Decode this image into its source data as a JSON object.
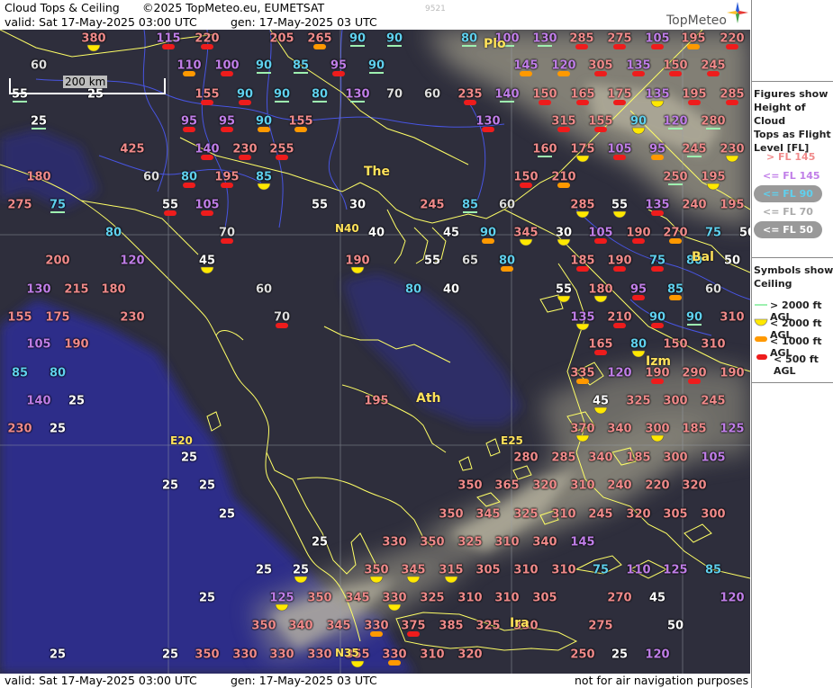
{
  "header": {
    "title": "Cloud Tops & Ceiling",
    "copyright": "©2025 TopMeteo.eu, EUMETSAT",
    "valid": "valid:  Sat  17-May-2025  03:00 UTC",
    "generated": "gen: 17-May-2025 03 UTC",
    "code": "9521",
    "brand": "TopMeteo"
  },
  "footer": {
    "valid": "valid:  Sat  17-May-2025  03:00 UTC",
    "generated": "gen: 17-May-2025 03 UTC",
    "disclaimer": "not for air navigation purposes"
  },
  "scale_label": "200 km",
  "colors": {
    "gt145": "#f08a8a",
    "le145": "#c07ee8",
    "le90": "#5fd0ee",
    "le70": "#dddddd",
    "le50": "#ffffff",
    "ceil_gt2000": "#9ef0b0",
    "ceil_lt2000": "#ffe800",
    "ceil_lt1000": "#ff9900",
    "ceil_lt500": "#ee1c1c",
    "coast": "#ffff66",
    "rivers": "#4d5cff"
  },
  "legend": {
    "figures_title": [
      "Figures show",
      "Height of Cloud",
      "Tops as Flight",
      "Level  [FL]"
    ],
    "fl_items": [
      "> FL 145",
      "<= FL 145",
      "<= FL 90",
      "<= FL 70",
      "<= FL 50"
    ],
    "symbols_title": [
      "Symbols show",
      "Ceiling"
    ],
    "ceil_items": [
      "> 2000 ft AGL",
      "< 2000 ft AGL",
      "< 1000 ft AGL",
      "< 500 ft AGL"
    ]
  },
  "places": [
    {
      "name": "Plo",
      "icon": "city-dot-icon"
    },
    {
      "name": "The",
      "icon": "city-dot-icon"
    },
    {
      "name": "Ath",
      "icon": "city-dot-icon"
    },
    {
      "name": "Izm",
      "icon": "city-dot-icon"
    },
    {
      "name": "Bal",
      "icon": "city-dot-icon"
    },
    {
      "name": "Ira",
      "icon": "city-dot-icon"
    }
  ],
  "grid_labels": [
    "N40",
    "E20",
    "E25",
    "N35"
  ],
  "points": [
    {
      "v": "380",
      "c": "gt145",
      "s": "lt2000"
    },
    {
      "v": "115",
      "c": "le145",
      "s": "lt500"
    },
    {
      "v": "220",
      "c": "gt145",
      "s": "lt500"
    },
    {
      "v": "205",
      "c": "gt145",
      "s": ""
    },
    {
      "v": "265",
      "c": "gt145",
      "s": "lt1000"
    },
    {
      "v": "90",
      "c": "le90",
      "s": "gt2000"
    },
    {
      "v": "90",
      "c": "le90",
      "s": "gt2000"
    },
    {
      "v": "80",
      "c": "le90",
      "s": "gt2000"
    },
    {
      "v": "100",
      "c": "le145",
      "s": "gt2000"
    },
    {
      "v": "130",
      "c": "le145",
      "s": "gt2000"
    },
    {
      "v": "285",
      "c": "gt145",
      "s": "lt500"
    },
    {
      "v": "275",
      "c": "gt145",
      "s": "lt500"
    },
    {
      "v": "105",
      "c": "le145",
      "s": "lt500"
    },
    {
      "v": "195",
      "c": "gt145",
      "s": "lt1000"
    },
    {
      "v": "220",
      "c": "gt145",
      "s": "lt500"
    },
    {
      "v": "60",
      "c": "le70",
      "s": ""
    },
    {
      "v": "110",
      "c": "le145",
      "s": "lt1000"
    },
    {
      "v": "100",
      "c": "le145",
      "s": "lt500"
    },
    {
      "v": "90",
      "c": "le90",
      "s": "gt2000"
    },
    {
      "v": "85",
      "c": "le90",
      "s": "gt2000"
    },
    {
      "v": "95",
      "c": "le145",
      "s": "lt500"
    },
    {
      "v": "90",
      "c": "le90",
      "s": "gt2000"
    },
    {
      "v": "145",
      "c": "le145",
      "s": "lt1000"
    },
    {
      "v": "120",
      "c": "le145",
      "s": "lt1000"
    },
    {
      "v": "305",
      "c": "gt145",
      "s": "lt500"
    },
    {
      "v": "135",
      "c": "le145",
      "s": "lt500"
    },
    {
      "v": "150",
      "c": "gt145",
      "s": "lt500"
    },
    {
      "v": "245",
      "c": "gt145",
      "s": "lt500"
    },
    {
      "v": "55",
      "c": "le50",
      "s": "gt2000"
    },
    {
      "v": "25",
      "c": "le50",
      "s": ""
    },
    {
      "v": "155",
      "c": "gt145",
      "s": "lt500"
    },
    {
      "v": "90",
      "c": "le90",
      "s": "lt500"
    },
    {
      "v": "90",
      "c": "le90",
      "s": "gt2000"
    },
    {
      "v": "80",
      "c": "le90",
      "s": "gt2000"
    },
    {
      "v": "130",
      "c": "le145",
      "s": "gt2000"
    },
    {
      "v": "70",
      "c": "le70",
      "s": ""
    },
    {
      "v": "60",
      "c": "le70",
      "s": ""
    },
    {
      "v": "235",
      "c": "gt145",
      "s": "lt500"
    },
    {
      "v": "140",
      "c": "le145",
      "s": "gt2000"
    },
    {
      "v": "150",
      "c": "gt145",
      "s": "lt500"
    },
    {
      "v": "165",
      "c": "gt145",
      "s": "lt500"
    },
    {
      "v": "175",
      "c": "gt145",
      "s": "lt500"
    },
    {
      "v": "135",
      "c": "le145",
      "s": "lt2000"
    },
    {
      "v": "195",
      "c": "gt145",
      "s": "lt500"
    },
    {
      "v": "285",
      "c": "gt145",
      "s": "lt500"
    },
    {
      "v": "25",
      "c": "le50",
      "s": "gt2000"
    },
    {
      "v": "95",
      "c": "le145",
      "s": "lt500"
    },
    {
      "v": "95",
      "c": "le145",
      "s": "lt500"
    },
    {
      "v": "90",
      "c": "le90",
      "s": "lt1000"
    },
    {
      "v": "155",
      "c": "gt145",
      "s": "lt1000"
    },
    {
      "v": "130",
      "c": "le145",
      "s": "lt500"
    },
    {
      "v": "315",
      "c": "gt145",
      "s": "lt500"
    },
    {
      "v": "155",
      "c": "gt145",
      "s": "lt500"
    },
    {
      "v": "90",
      "c": "le90",
      "s": "lt2000"
    },
    {
      "v": "120",
      "c": "le145",
      "s": "gt2000"
    },
    {
      "v": "280",
      "c": "gt145",
      "s": "gt2000"
    },
    {
      "v": "425",
      "c": "gt145",
      "s": ""
    },
    {
      "v": "140",
      "c": "le145",
      "s": "lt500"
    },
    {
      "v": "230",
      "c": "gt145",
      "s": "lt500"
    },
    {
      "v": "255",
      "c": "gt145",
      "s": "lt500"
    },
    {
      "v": "160",
      "c": "gt145",
      "s": "gt2000"
    },
    {
      "v": "175",
      "c": "gt145",
      "s": "lt2000"
    },
    {
      "v": "105",
      "c": "le145",
      "s": "lt500"
    },
    {
      "v": "95",
      "c": "le145",
      "s": "lt1000"
    },
    {
      "v": "245",
      "c": "gt145",
      "s": "gt2000"
    },
    {
      "v": "230",
      "c": "gt145",
      "s": "lt2000"
    },
    {
      "v": "180",
      "c": "gt145",
      "s": ""
    },
    {
      "v": "60",
      "c": "le70",
      "s": ""
    },
    {
      "v": "80",
      "c": "le90",
      "s": "lt500"
    },
    {
      "v": "195",
      "c": "gt145",
      "s": "lt500"
    },
    {
      "v": "85",
      "c": "le90",
      "s": "lt2000"
    },
    {
      "v": "150",
      "c": "gt145",
      "s": "lt500"
    },
    {
      "v": "210",
      "c": "gt145",
      "s": "lt1000"
    },
    {
      "v": "250",
      "c": "gt145",
      "s": "gt2000"
    },
    {
      "v": "195",
      "c": "gt145",
      "s": "lt2000"
    },
    {
      "v": "275",
      "c": "gt145",
      "s": ""
    },
    {
      "v": "75",
      "c": "le90",
      "s": "gt2000"
    },
    {
      "v": "55",
      "c": "le50",
      "s": "lt500"
    },
    {
      "v": "105",
      "c": "le145",
      "s": "lt500"
    },
    {
      "v": "55",
      "c": "le50",
      "s": ""
    },
    {
      "v": "30",
      "c": "le50",
      "s": ""
    },
    {
      "v": "245",
      "c": "gt145",
      "s": ""
    },
    {
      "v": "85",
      "c": "le90",
      "s": "gt2000"
    },
    {
      "v": "60",
      "c": "le70",
      "s": ""
    },
    {
      "v": "285",
      "c": "gt145",
      "s": "lt2000"
    },
    {
      "v": "55",
      "c": "le50",
      "s": "lt2000"
    },
    {
      "v": "135",
      "c": "le145",
      "s": "lt500"
    },
    {
      "v": "240",
      "c": "gt145",
      "s": ""
    },
    {
      "v": "195",
      "c": "gt145",
      "s": ""
    },
    {
      "v": "80",
      "c": "le90",
      "s": ""
    },
    {
      "v": "70",
      "c": "le70",
      "s": "lt500"
    },
    {
      "v": "40",
      "c": "le50",
      "s": ""
    },
    {
      "v": "45",
      "c": "le50",
      "s": ""
    },
    {
      "v": "90",
      "c": "le90",
      "s": "lt1000"
    },
    {
      "v": "345",
      "c": "gt145",
      "s": "lt2000"
    },
    {
      "v": "30",
      "c": "le50",
      "s": "lt2000"
    },
    {
      "v": "105",
      "c": "le145",
      "s": "lt500"
    },
    {
      "v": "190",
      "c": "gt145",
      "s": "lt500"
    },
    {
      "v": "270",
      "c": "gt145",
      "s": "lt1000"
    },
    {
      "v": "75",
      "c": "le90",
      "s": ""
    },
    {
      "v": "50",
      "c": "le50",
      "s": ""
    },
    {
      "v": "200",
      "c": "gt145",
      "s": ""
    },
    {
      "v": "120",
      "c": "le145",
      "s": ""
    },
    {
      "v": "45",
      "c": "le50",
      "s": "lt2000"
    },
    {
      "v": "190",
      "c": "gt145",
      "s": "lt2000"
    },
    {
      "v": "55",
      "c": "le50",
      "s": ""
    },
    {
      "v": "65",
      "c": "le70",
      "s": ""
    },
    {
      "v": "80",
      "c": "le90",
      "s": "lt1000"
    },
    {
      "v": "185",
      "c": "gt145",
      "s": "lt500"
    },
    {
      "v": "190",
      "c": "gt145",
      "s": "lt500"
    },
    {
      "v": "75",
      "c": "le90",
      "s": "lt500"
    },
    {
      "v": "80",
      "c": "le90",
      "s": ""
    },
    {
      "v": "50",
      "c": "le50",
      "s": ""
    },
    {
      "v": "130",
      "c": "le145",
      "s": ""
    },
    {
      "v": "215",
      "c": "gt145",
      "s": ""
    },
    {
      "v": "180",
      "c": "gt145",
      "s": ""
    },
    {
      "v": "60",
      "c": "le70",
      "s": ""
    },
    {
      "v": "80",
      "c": "le90",
      "s": ""
    },
    {
      "v": "40",
      "c": "le50",
      "s": ""
    },
    {
      "v": "55",
      "c": "le50",
      "s": "lt2000"
    },
    {
      "v": "180",
      "c": "gt145",
      "s": "lt2000"
    },
    {
      "v": "95",
      "c": "le145",
      "s": "lt500"
    },
    {
      "v": "85",
      "c": "le90",
      "s": "lt1000"
    },
    {
      "v": "60",
      "c": "le70",
      "s": ""
    },
    {
      "v": "155",
      "c": "gt145",
      "s": ""
    },
    {
      "v": "175",
      "c": "gt145",
      "s": ""
    },
    {
      "v": "230",
      "c": "gt145",
      "s": ""
    },
    {
      "v": "70",
      "c": "le70",
      "s": "lt500"
    },
    {
      "v": "135",
      "c": "le145",
      "s": "lt2000"
    },
    {
      "v": "210",
      "c": "gt145",
      "s": "lt500"
    },
    {
      "v": "90",
      "c": "le90",
      "s": "lt500"
    },
    {
      "v": "90",
      "c": "le90",
      "s": "gt2000"
    },
    {
      "v": "310",
      "c": "gt145",
      "s": ""
    },
    {
      "v": "105",
      "c": "le145",
      "s": ""
    },
    {
      "v": "190",
      "c": "gt145",
      "s": ""
    },
    {
      "v": "165",
      "c": "gt145",
      "s": "lt500"
    },
    {
      "v": "80",
      "c": "le90",
      "s": "lt2000"
    },
    {
      "v": "150",
      "c": "gt145",
      "s": ""
    },
    {
      "v": "310",
      "c": "gt145",
      "s": ""
    },
    {
      "v": "85",
      "c": "le90",
      "s": ""
    },
    {
      "v": "80",
      "c": "le90",
      "s": ""
    },
    {
      "v": "335",
      "c": "gt145",
      "s": "lt1000"
    },
    {
      "v": "120",
      "c": "le145",
      "s": ""
    },
    {
      "v": "190",
      "c": "gt145",
      "s": "lt500"
    },
    {
      "v": "290",
      "c": "gt145",
      "s": "lt500"
    },
    {
      "v": "190",
      "c": "gt145",
      "s": ""
    },
    {
      "v": "140",
      "c": "le145",
      "s": ""
    },
    {
      "v": "25",
      "c": "le50",
      "s": ""
    },
    {
      "v": "195",
      "c": "gt145",
      "s": ""
    },
    {
      "v": "45",
      "c": "le50",
      "s": "lt2000"
    },
    {
      "v": "325",
      "c": "gt145",
      "s": ""
    },
    {
      "v": "300",
      "c": "gt145",
      "s": ""
    },
    {
      "v": "245",
      "c": "gt145",
      "s": ""
    },
    {
      "v": "230",
      "c": "gt145",
      "s": ""
    },
    {
      "v": "25",
      "c": "le50",
      "s": ""
    },
    {
      "v": "370",
      "c": "gt145",
      "s": "lt2000"
    },
    {
      "v": "340",
      "c": "gt145",
      "s": ""
    },
    {
      "v": "300",
      "c": "gt145",
      "s": "lt2000"
    },
    {
      "v": "185",
      "c": "gt145",
      "s": ""
    },
    {
      "v": "125",
      "c": "le145",
      "s": ""
    },
    {
      "v": "25",
      "c": "le50",
      "s": ""
    },
    {
      "v": "280",
      "c": "gt145",
      "s": ""
    },
    {
      "v": "285",
      "c": "gt145",
      "s": ""
    },
    {
      "v": "340",
      "c": "gt145",
      "s": ""
    },
    {
      "v": "185",
      "c": "gt145",
      "s": ""
    },
    {
      "v": "300",
      "c": "gt145",
      "s": ""
    },
    {
      "v": "105",
      "c": "le145",
      "s": ""
    },
    {
      "v": "25",
      "c": "le50",
      "s": ""
    },
    {
      "v": "25",
      "c": "le50",
      "s": ""
    },
    {
      "v": "350",
      "c": "gt145",
      "s": ""
    },
    {
      "v": "365",
      "c": "gt145",
      "s": ""
    },
    {
      "v": "320",
      "c": "gt145",
      "s": ""
    },
    {
      "v": "310",
      "c": "gt145",
      "s": ""
    },
    {
      "v": "240",
      "c": "gt145",
      "s": ""
    },
    {
      "v": "220",
      "c": "gt145",
      "s": ""
    },
    {
      "v": "320",
      "c": "gt145",
      "s": ""
    },
    {
      "v": "25",
      "c": "le50",
      "s": ""
    },
    {
      "v": "350",
      "c": "gt145",
      "s": ""
    },
    {
      "v": "345",
      "c": "gt145",
      "s": ""
    },
    {
      "v": "325",
      "c": "gt145",
      "s": ""
    },
    {
      "v": "310",
      "c": "gt145",
      "s": ""
    },
    {
      "v": "245",
      "c": "gt145",
      "s": ""
    },
    {
      "v": "320",
      "c": "gt145",
      "s": ""
    },
    {
      "v": "305",
      "c": "gt145",
      "s": ""
    },
    {
      "v": "300",
      "c": "gt145",
      "s": ""
    },
    {
      "v": "25",
      "c": "le50",
      "s": ""
    },
    {
      "v": "330",
      "c": "gt145",
      "s": ""
    },
    {
      "v": "350",
      "c": "gt145",
      "s": ""
    },
    {
      "v": "325",
      "c": "gt145",
      "s": ""
    },
    {
      "v": "310",
      "c": "gt145",
      "s": ""
    },
    {
      "v": "340",
      "c": "gt145",
      "s": ""
    },
    {
      "v": "145",
      "c": "le145",
      "s": ""
    },
    {
      "v": "25",
      "c": "le50",
      "s": ""
    },
    {
      "v": "25",
      "c": "le50",
      "s": "lt2000"
    },
    {
      "v": "350",
      "c": "gt145",
      "s": "lt2000"
    },
    {
      "v": "345",
      "c": "gt145",
      "s": "lt2000"
    },
    {
      "v": "315",
      "c": "gt145",
      "s": "lt2000"
    },
    {
      "v": "305",
      "c": "gt145",
      "s": ""
    },
    {
      "v": "310",
      "c": "gt145",
      "s": ""
    },
    {
      "v": "310",
      "c": "gt145",
      "s": ""
    },
    {
      "v": "75",
      "c": "le90",
      "s": ""
    },
    {
      "v": "110",
      "c": "le145",
      "s": ""
    },
    {
      "v": "125",
      "c": "le145",
      "s": ""
    },
    {
      "v": "85",
      "c": "le90",
      "s": ""
    },
    {
      "v": "25",
      "c": "le50",
      "s": ""
    },
    {
      "v": "125",
      "c": "le145",
      "s": "lt2000"
    },
    {
      "v": "350",
      "c": "gt145",
      "s": ""
    },
    {
      "v": "345",
      "c": "gt145",
      "s": ""
    },
    {
      "v": "330",
      "c": "gt145",
      "s": "lt2000"
    },
    {
      "v": "325",
      "c": "gt145",
      "s": ""
    },
    {
      "v": "310",
      "c": "gt145",
      "s": ""
    },
    {
      "v": "310",
      "c": "gt145",
      "s": ""
    },
    {
      "v": "305",
      "c": "gt145",
      "s": ""
    },
    {
      "v": "270",
      "c": "gt145",
      "s": ""
    },
    {
      "v": "45",
      "c": "le50",
      "s": ""
    },
    {
      "v": "120",
      "c": "le145",
      "s": ""
    },
    {
      "v": "350",
      "c": "gt145",
      "s": ""
    },
    {
      "v": "340",
      "c": "gt145",
      "s": ""
    },
    {
      "v": "345",
      "c": "gt145",
      "s": ""
    },
    {
      "v": "330",
      "c": "gt145",
      "s": "lt1000"
    },
    {
      "v": "375",
      "c": "gt145",
      "s": "lt500"
    },
    {
      "v": "385",
      "c": "gt145",
      "s": ""
    },
    {
      "v": "325",
      "c": "gt145",
      "s": ""
    },
    {
      "v": "330",
      "c": "gt145",
      "s": ""
    },
    {
      "v": "275",
      "c": "gt145",
      "s": ""
    },
    {
      "v": "50",
      "c": "le50",
      "s": ""
    },
    {
      "v": "25",
      "c": "le50",
      "s": ""
    },
    {
      "v": "25",
      "c": "le50",
      "s": ""
    },
    {
      "v": "350",
      "c": "gt145",
      "s": ""
    },
    {
      "v": "330",
      "c": "gt145",
      "s": ""
    },
    {
      "v": "330",
      "c": "gt145",
      "s": ""
    },
    {
      "v": "330",
      "c": "gt145",
      "s": ""
    },
    {
      "v": "355",
      "c": "gt145",
      "s": "lt2000"
    },
    {
      "v": "330",
      "c": "gt145",
      "s": "lt1000"
    },
    {
      "v": "310",
      "c": "gt145",
      "s": ""
    },
    {
      "v": "320",
      "c": "gt145",
      "s": ""
    },
    {
      "v": "250",
      "c": "gt145",
      "s": ""
    },
    {
      "v": "25",
      "c": "le50",
      "s": ""
    },
    {
      "v": "120",
      "c": "le145",
      "s": ""
    }
  ]
}
